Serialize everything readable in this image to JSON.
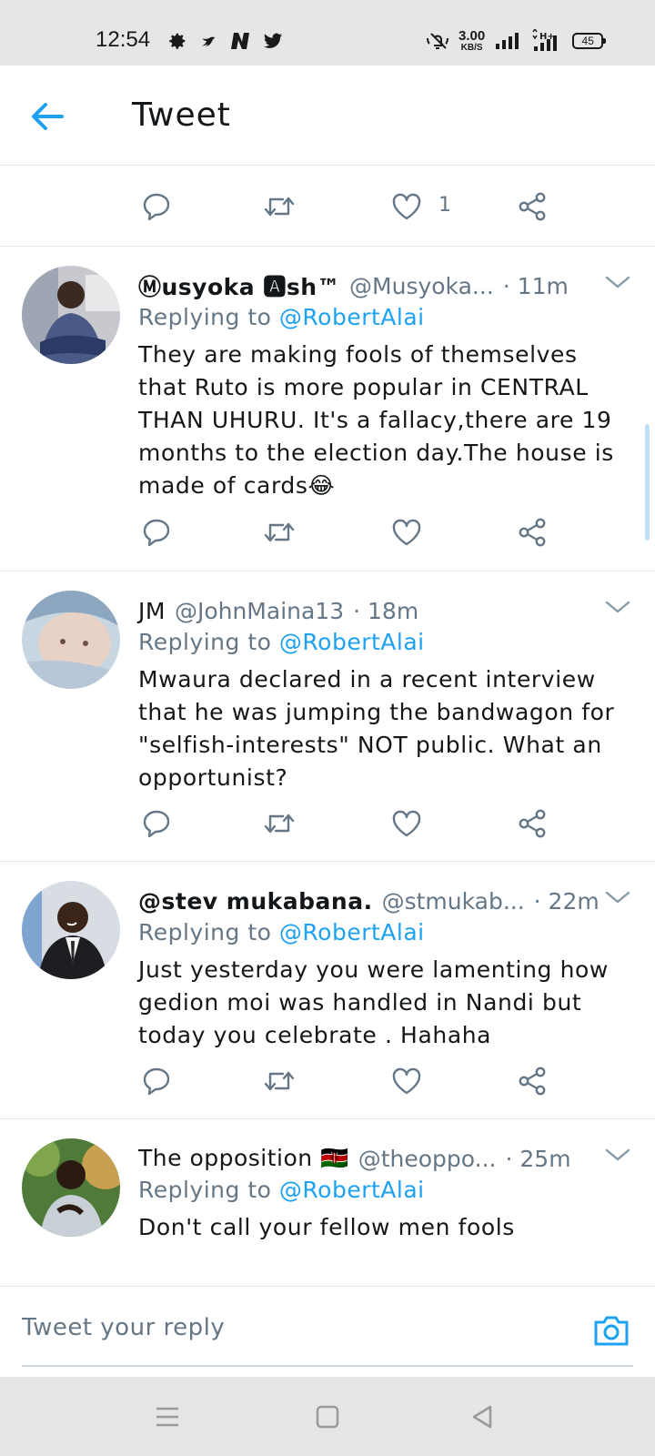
{
  "status_bar": {
    "time": "12:54",
    "net_speed_value": "3.00",
    "net_speed_unit": "KB/S",
    "battery": "45"
  },
  "header": {
    "title": "Tweet"
  },
  "colors": {
    "accent": "#1da1f2",
    "secondary_text": "#657786",
    "divider": "#e1e8ed"
  },
  "partial_tweet": {
    "like_count": "1"
  },
  "tweets": [
    {
      "display_name": "Ⓜusyoka 🅰sh™",
      "handle": "@Musyoka...",
      "time": "· 11m",
      "replying_prefix": "Replying to",
      "replying_to": "@RobertAlai",
      "text": "They are making fools of themselves that Ruto is more popular in CENTRAL THAN UHURU. It's a fallacy,there are 19 months to the election day.The house is made of cards😂"
    },
    {
      "display_name": "JM",
      "handle": "@JohnMaina13",
      "time": "· 18m",
      "replying_prefix": "Replying to",
      "replying_to": "@RobertAlai",
      "text": "Mwaura declared in a recent interview that he was jumping the bandwagon for \"selfish-interests\" NOT public. What an opportunist?"
    },
    {
      "display_name": "@stev mukabana.",
      "handle": "@stmukab...",
      "time": "· 22m",
      "replying_prefix": "Replying to",
      "replying_to": "@RobertAlai",
      "text": "Just yesterday you were lamenting how gedion moi was handled in Nandi but today you celebrate . Hahaha"
    },
    {
      "display_name": "The opposition 🇰🇪",
      "handle": "@theoppo...",
      "time": "· 25m",
      "replying_prefix": "Replying to",
      "replying_to": "@RobertAlai",
      "text": "Don't call your fellow men fools"
    }
  ],
  "reply_bar": {
    "placeholder": "Tweet your reply"
  }
}
